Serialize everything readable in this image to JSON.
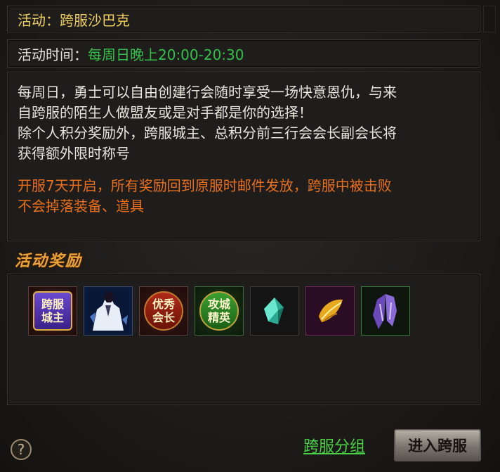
{
  "activity": {
    "name_label": "活动：",
    "name_value": "跨服沙巴克",
    "time_label": "活动时间：",
    "time_value": "每周日晚上20:00-20:30"
  },
  "description": {
    "line1": "每周日，勇士可以自由创建行会随时享受一场快意恩仇，与来",
    "line2": "自跨服的陌生人做盟友或是对手都是你的选择！",
    "line3": "除个人积分奖励外，跨服城主、总积分前三行会会长副会长将",
    "line4": "获得额外限时称号",
    "notice1": "开服7天开启，所有奖励回到原服时邮件发放，跨服中被击败",
    "notice2": "不会掉落装备、道具"
  },
  "rewards": {
    "title": "活动奖励",
    "items": [
      {
        "icon": "cross-server-lord-title-icon",
        "text1": "跨服",
        "text2": "城主"
      },
      {
        "icon": "character-fashion-icon"
      },
      {
        "icon": "excellent-leader-title-icon",
        "text1": "优秀",
        "text2": "会长"
      },
      {
        "icon": "siege-elite-title-icon",
        "text1": "攻城",
        "text2": "精英"
      },
      {
        "icon": "crystal-gem-icon"
      },
      {
        "icon": "golden-feather-icon"
      },
      {
        "icon": "purple-wings-icon"
      }
    ]
  },
  "footer": {
    "help_symbol": "?",
    "group_link": "跨服分组",
    "enter_button": "进入跨服"
  },
  "colors": {
    "label_yellow": "#f0d060",
    "time_green": "#35c04a",
    "notice_orange": "#e8701c"
  }
}
